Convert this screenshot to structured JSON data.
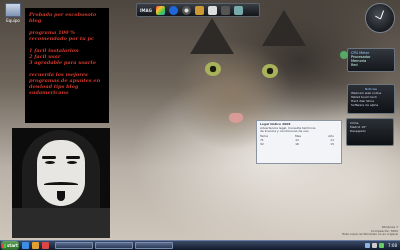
{
  "desktop": {
    "icon_label": "Equipo"
  },
  "blog_panel": {
    "line1": "Probado por escobosoto blog",
    "line2": "programa 100 % recomendado por tu pc",
    "line3": "1 facil instalarion",
    "line4": "2 facil usar",
    "line5": "3 agradable para usarlo",
    "line6": "recuerda los mejores programas de apuntes en dowload tips blog sudamericano"
  },
  "gadget_bar": {
    "label": "IMAG"
  },
  "cpu_gadget": {
    "title": "CPU Meter",
    "line1": "Procesador",
    "line2": "Memoria",
    "line3": "Red"
  },
  "net_gadget": {
    "title": "Noticias",
    "line1": "Webcam web online",
    "line2": "Tablet touch tech",
    "line3": "Hard disk Store",
    "line4": "Software de alpha"
  },
  "weather_gadget": {
    "line1": "Clima",
    "line2": "Madrid 19°",
    "line3": "Despejado"
  },
  "popup": {
    "title": "Legal Notice 2008",
    "desc1": "Advertencia legal. Consulte términos",
    "desc2": "de licencia y condiciones de uso.",
    "rows": [
      {
        "a": "Tema",
        "b": "Mes",
        "c": "Año"
      },
      {
        "a": "71",
        "b": "12",
        "c": "11"
      },
      {
        "a": "32",
        "b": "16",
        "c": "15"
      }
    ]
  },
  "win_info": {
    "line1": "Windows 7",
    "line2": "Compilación 7600",
    "line3": "Esta copia de Windows no es original"
  },
  "taskbar": {
    "start_label": "start",
    "time": "7:08"
  }
}
